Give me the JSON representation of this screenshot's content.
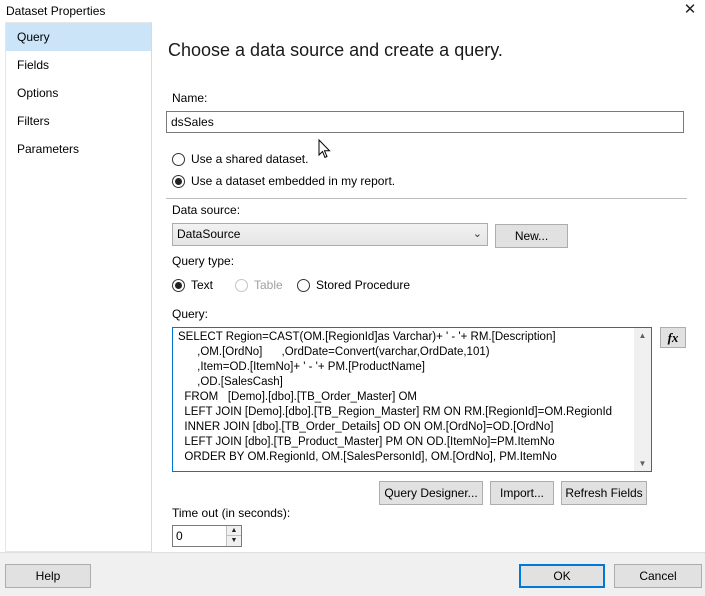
{
  "window": {
    "title": "Dataset Properties",
    "close_glyph": "✕"
  },
  "sidebar": {
    "items": [
      {
        "label": "Query",
        "selected": true
      },
      {
        "label": "Fields",
        "selected": false
      },
      {
        "label": "Options",
        "selected": false
      },
      {
        "label": "Filters",
        "selected": false
      },
      {
        "label": "Parameters",
        "selected": false
      }
    ]
  },
  "main": {
    "heading": "Choose a data source and create a query.",
    "name_label": "Name:",
    "name_value": "dsSales",
    "dataset_options": [
      {
        "label": "Use a shared dataset.",
        "checked": false
      },
      {
        "label": "Use a dataset embedded in my report.",
        "checked": true
      }
    ],
    "data_source_label": "Data source:",
    "data_source_value": "DataSource",
    "new_button": "New...",
    "query_type_label": "Query type:",
    "query_types": [
      {
        "label": "Text",
        "checked": true,
        "enabled": true
      },
      {
        "label": "Table",
        "checked": false,
        "enabled": false
      },
      {
        "label": "Stored Procedure",
        "checked": false,
        "enabled": true
      }
    ],
    "query_label": "Query:",
    "query_text": "SELECT Region=CAST(OM.[RegionId]as Varchar)+ ' - '+ RM.[Description]\n      ,OM.[OrdNo]      ,OrdDate=Convert(varchar,OrdDate,101)\n      ,Item=OD.[ItemNo]+ ' - '+ PM.[ProductName]\n      ,OD.[SalesCash]\n  FROM   [Demo].[dbo].[TB_Order_Master] OM\n  LEFT JOIN [Demo].[dbo].[TB_Region_Master] RM ON RM.[RegionId]=OM.RegionId\n  INNER JOIN [dbo].[TB_Order_Details] OD ON OM.[OrdNo]=OD.[OrdNo]\n  LEFT JOIN [dbo].[TB_Product_Master] PM ON OD.[ItemNo]=PM.ItemNo\n  ORDER BY OM.RegionId, OM.[SalesPersonId], OM.[OrdNo], PM.ItemNo",
    "fx_button": "fx",
    "query_designer_button": "Query Designer...",
    "import_button": "Import...",
    "refresh_fields_button": "Refresh Fields",
    "timeout_label": "Time out (in seconds):",
    "timeout_value": "0"
  },
  "footer": {
    "help_button": "Help",
    "ok_button": "OK",
    "cancel_button": "Cancel"
  },
  "colors": {
    "accent": "#0078d7",
    "selection": "#cce4f7"
  }
}
